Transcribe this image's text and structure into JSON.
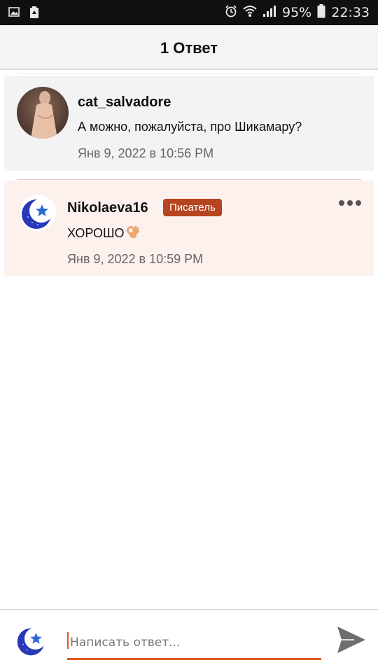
{
  "status_bar": {
    "battery_percent": "95%",
    "time": "22:33",
    "icons": [
      "image-icon",
      "recycle-icon",
      "alarm-icon",
      "wifi-icon",
      "signal-icon",
      "battery-icon"
    ]
  },
  "header": {
    "title": "1 Ответ"
  },
  "comments": [
    {
      "username": "cat_salvadore",
      "text": "А можно, пожалуйста, про Шикамару?",
      "timestamp": "Янв 9, 2022 в 10:56 PM"
    },
    {
      "username": "Nikolaeva16",
      "badge": "Писатель",
      "text": "ХОРОШО",
      "emoji_icon": "ok-hand-icon",
      "timestamp": "Янв 9, 2022 в 10:59 PM"
    }
  ],
  "reply": {
    "placeholder": "Написать ответ...",
    "send_icon": "send-icon"
  },
  "colors": {
    "accent": "#e0571f",
    "badge_bg": "#b5441f",
    "highlight_bg": "#fdf1ee",
    "comment_bg": "#f3f3f6"
  }
}
